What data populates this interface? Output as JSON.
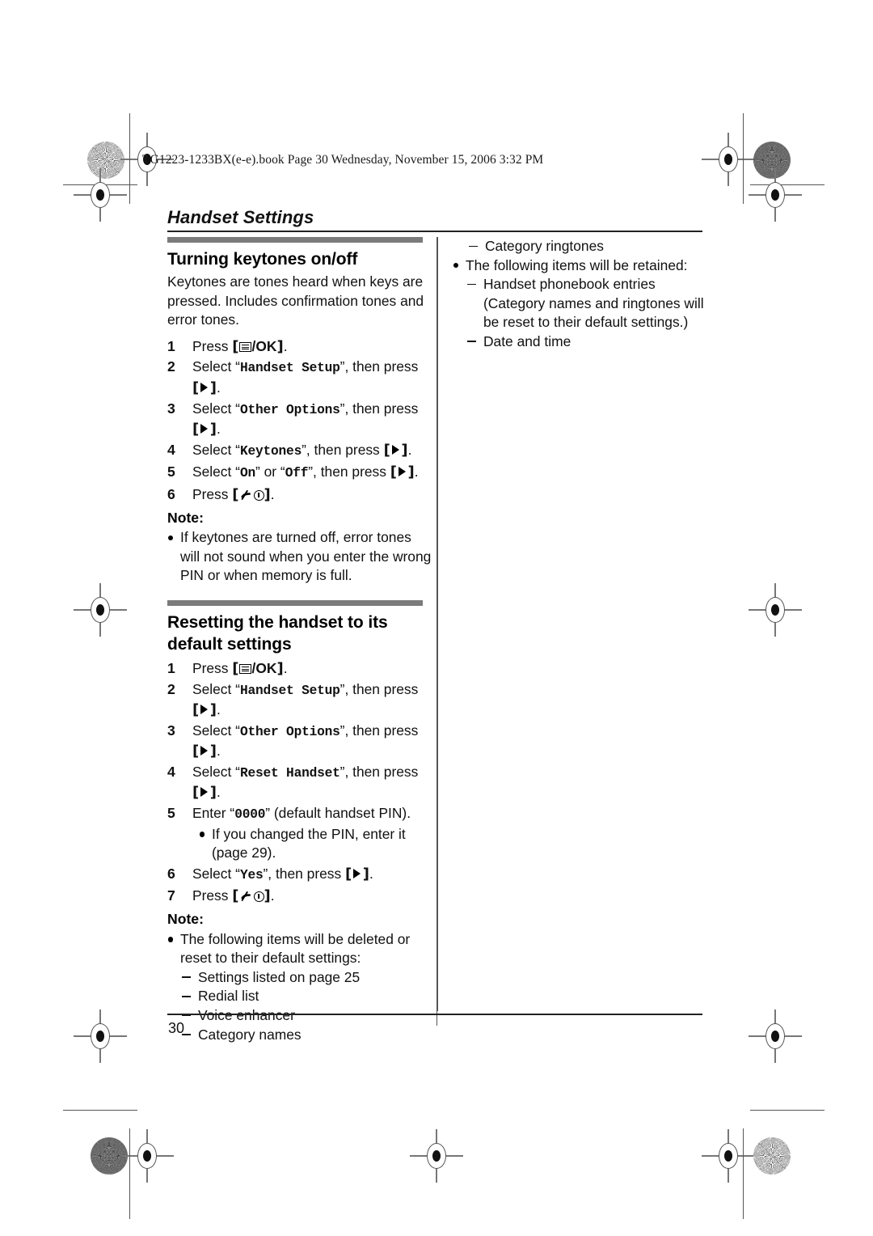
{
  "header": {
    "file_line": "TG1223-1233BX(e-e).book  Page 30  Wednesday, November 15, 2006  3:32 PM"
  },
  "running_head": "Handset Settings",
  "folio": "30",
  "icons": {
    "menu_ok": "menu-ok-key-icon",
    "right_arrow": "right-arrow-key-icon",
    "off_power": "off-power-key-icon",
    "registration": "registration-mark-icon",
    "rosette": "rosette-density-mark-icon"
  },
  "keys": {
    "menu_ok_label": "/OK",
    "bracket_open": "[",
    "bracket_close": "]"
  },
  "left_column": {
    "section_1": {
      "heading": "Turning keytones on/off",
      "intro": "Keytones are tones heard when keys are pressed. Includes confirmation tones and error tones.",
      "steps": [
        {
          "num": "1",
          "pre": "Press ",
          "key": "menu_ok",
          "post": "."
        },
        {
          "num": "2",
          "pre": "Select “",
          "mono": "Handset Setup",
          "mid": "”, then press ",
          "key": "arrow",
          "post": "."
        },
        {
          "num": "3",
          "pre": "Select “",
          "mono": "Other Options",
          "mid": "”, then press ",
          "key": "arrow",
          "post": "."
        },
        {
          "num": "4",
          "pre": "Select “",
          "mono": "Keytones",
          "mid": "”, then press ",
          "key": "arrow",
          "post": "."
        },
        {
          "num": "5",
          "pre": "Select “",
          "mono": "On",
          "mid2": "” or “",
          "mono2": "Off",
          "mid": "”, then press ",
          "key": "arrow",
          "post": "."
        },
        {
          "num": "6",
          "pre": "Press ",
          "key": "off",
          "post": "."
        }
      ],
      "note_label": "Note:",
      "notes": [
        "If keytones are turned off, error tones will not sound when you enter the wrong PIN or when memory is full."
      ]
    },
    "section_2": {
      "heading": "Resetting the handset to its default settings",
      "steps": [
        {
          "num": "1",
          "pre": "Press ",
          "key": "menu_ok",
          "post": "."
        },
        {
          "num": "2",
          "pre": "Select “",
          "mono": "Handset Setup",
          "mid": "”, then press ",
          "key": "arrow",
          "post": "."
        },
        {
          "num": "3",
          "pre": "Select “",
          "mono": "Other Options",
          "mid": "”, then press ",
          "key": "arrow",
          "post": "."
        },
        {
          "num": "4",
          "pre": "Select “",
          "mono": "Reset Handset",
          "mid": "”, then press ",
          "key": "arrow",
          "post": "."
        },
        {
          "num": "5",
          "pre": "Enter “",
          "mono": "0000",
          "mid": "” (default handset PIN).",
          "substep": "If you changed the PIN, enter it (page 29)."
        },
        {
          "num": "6",
          "pre": "Select “",
          "mono": "Yes",
          "mid": "”, then press ",
          "key": "arrow",
          "post": "."
        },
        {
          "num": "7",
          "pre": "Press ",
          "key": "off",
          "post": "."
        }
      ],
      "note_label": "Note:",
      "note_lead": "The following items will be deleted or reset to their default settings:",
      "note_items": [
        "Settings listed on page 25",
        "Redial list",
        "Voice enhancer",
        "Category names"
      ]
    }
  },
  "right_column": {
    "continued_items": [
      "Category ringtones"
    ],
    "retained_lead": "The following items will be retained:",
    "retained_items": [
      "Handset phonebook entries (Category names and ringtones will be reset to their default settings.)",
      "Date and time"
    ]
  }
}
